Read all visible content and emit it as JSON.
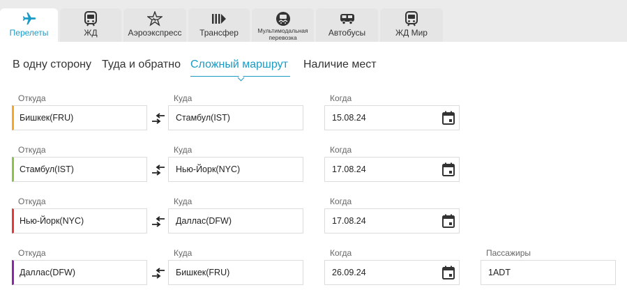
{
  "tabs": [
    {
      "label": "Перелеты",
      "icon": "plane-icon",
      "active": true
    },
    {
      "label": "ЖД",
      "icon": "train-icon"
    },
    {
      "label": "Аэроэкспресс",
      "icon": "aeroexpress-icon"
    },
    {
      "label": "Трансфер",
      "icon": "transfer-icon"
    },
    {
      "label": "Мультимодальная перевозка",
      "icon": "multimodal-icon"
    },
    {
      "label": "Автобусы",
      "icon": "bus-icon"
    },
    {
      "label": "ЖД Мир",
      "icon": "train-icon"
    }
  ],
  "modes": [
    "В одну сторону",
    "Туда и обратно",
    "Сложный маршрут",
    "Наличие мест"
  ],
  "active_mode": "Сложный маршрут",
  "labels": {
    "from": "Откуда",
    "to": "Куда",
    "when": "Когда",
    "passengers": "Пассажиры"
  },
  "segments": [
    {
      "from": "Бишкек(FRU)",
      "to": "Стамбул(IST)",
      "date": "15.08.24",
      "accent": "#f5a623"
    },
    {
      "from": "Стамбул(IST)",
      "to": "Нью-Йорк(NYC)",
      "date": "17.08.24",
      "accent": "#8bc34a"
    },
    {
      "from": "Нью-Йорк(NYC)",
      "to": "Даллас(DFW)",
      "date": "17.08.24",
      "accent": "#e53935"
    },
    {
      "from": "Даллас(DFW)",
      "to": "Бишкек(FRU)",
      "date": "26.09.24",
      "accent": "#8e24aa"
    }
  ],
  "passengers": "1ADT",
  "colors": {
    "accent": "#1a9bc6",
    "tab_bg": "#e5e5e5",
    "border": "#dcdcdc"
  }
}
